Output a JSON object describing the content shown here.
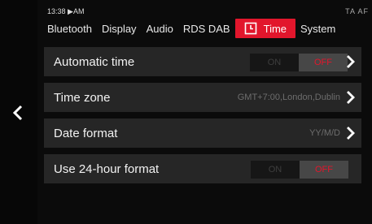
{
  "status": {
    "time": "13:38 ▶AM",
    "right": "TA AF"
  },
  "tabs": [
    {
      "label": "Bluetooth"
    },
    {
      "label": "Display"
    },
    {
      "label": "Audio"
    },
    {
      "label": "RDS DAB"
    },
    {
      "label": "Time",
      "icon": "clock-icon",
      "active": true
    },
    {
      "label": "System"
    }
  ],
  "settings": {
    "automatic_time": {
      "label": "Automatic time",
      "on": "ON",
      "off": "OFF",
      "state": "OFF"
    },
    "time_zone": {
      "label": "Time zone",
      "value": "GMT+7:00,London,Dublin"
    },
    "date_format": {
      "label": "Date format",
      "value": "YY/M/D"
    },
    "hour24": {
      "label": "Use 24-hour format",
      "on": "ON",
      "off": "OFF",
      "state": "OFF"
    }
  },
  "colors": {
    "accent": "#e2162c",
    "row_bg": "#262626",
    "bg": "#0b0b0b"
  }
}
